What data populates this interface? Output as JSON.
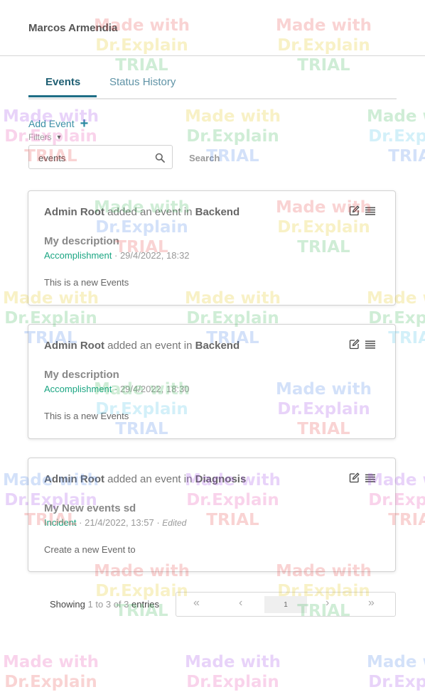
{
  "header": {
    "user_name": "Marcos Armendia"
  },
  "tabs": [
    {
      "label": "Events",
      "active": true
    },
    {
      "label": "Status History",
      "active": false
    }
  ],
  "actions": {
    "add_event": "Add Event",
    "filters": "Filters",
    "search_button": "Search"
  },
  "search": {
    "value": "events"
  },
  "events": [
    {
      "author": "Admin Root",
      "added_text": "added an event in",
      "category": "Backend",
      "title": "My description",
      "type": "Accomplishment",
      "datetime": "29/4/2022, 18:32",
      "edited": "",
      "description": "This is a new Events"
    },
    {
      "author": "Admin Root",
      "added_text": "added an event in",
      "category": "Backend",
      "title": "My description",
      "type": "Accomplishment",
      "datetime": "29/4/2022, 18:30",
      "edited": "",
      "description": "This is a new Events"
    },
    {
      "author": "Admin Root",
      "added_text": "added an event in",
      "category": "Diagnosis",
      "title": "My New events sd",
      "type": "Incident",
      "datetime": "21/4/2022, 13:57",
      "edited": "Edited",
      "description": "Create a new Event to"
    }
  ],
  "pagination": {
    "showing_prefix": "Showing",
    "from": "1",
    "to_word": "to",
    "to": "3",
    "of_word": "of",
    "total": "3",
    "suffix": "entries",
    "current_page": "1",
    "first": "«",
    "prev": "‹",
    "next": "›",
    "last": "»"
  },
  "watermark": {
    "line1": "Made with",
    "line2": "Dr.Explain",
    "line3": "TRIAL"
  },
  "colors": {
    "accent": "#1f6e86",
    "tag_green": "#1aa582"
  }
}
